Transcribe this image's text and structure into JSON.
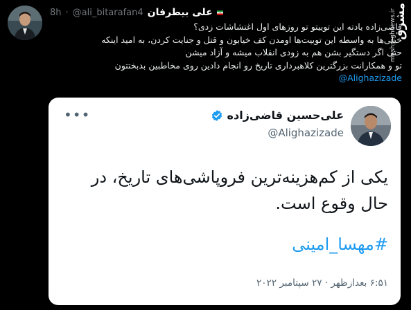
{
  "tweet": {
    "author": {
      "display_name": "علی بیطرفان",
      "flag_icon": "iran-flag-icon",
      "handle": "@ali_bitarafan4",
      "separator": "·",
      "time": "8h"
    },
    "text_lines": [
      "قاضی‌زاده یادته این توییتو تو روزهای اول اغتشاشات زدی؟",
      "خیلی‌ها به واسطه این توییت‌ها اومدن کف خیابون و قتل و جنایت کردن، به امید اینکه",
      "حتی اگر دستگیر بشن هم به زودی انقلاب میشه و آزاد میشن",
      "تو و همکارانت بزرگترین کلاهبرداری تاریخ رو انجام دادین روی مخاطبین بدبختتون"
    ],
    "mention": "@Alighazizade"
  },
  "watermark": {
    "brand": "مشرق",
    "site": "mashreghnews.ir"
  },
  "quoted": {
    "name": "علی‌حسین قاضی‌زاده",
    "handle": "@Alighazizade",
    "verified_icon": "verified-badge-icon",
    "more_icon": "more-options-icon",
    "body_lines": [
      "یکی از کم‌هزینه‌ترین فروپاشی‌های تاریخ، در",
      "حال وقوع است."
    ],
    "hashtag": "#مهسا_امینی",
    "timestamp": "۶:۵۱ بعدازظهر · ۲۷ سپتامبر ۲۰۲۲"
  },
  "colors": {
    "background": "#000000",
    "card_background": "#ffffff",
    "link": "#1d9bf0",
    "muted": "#71767b"
  }
}
